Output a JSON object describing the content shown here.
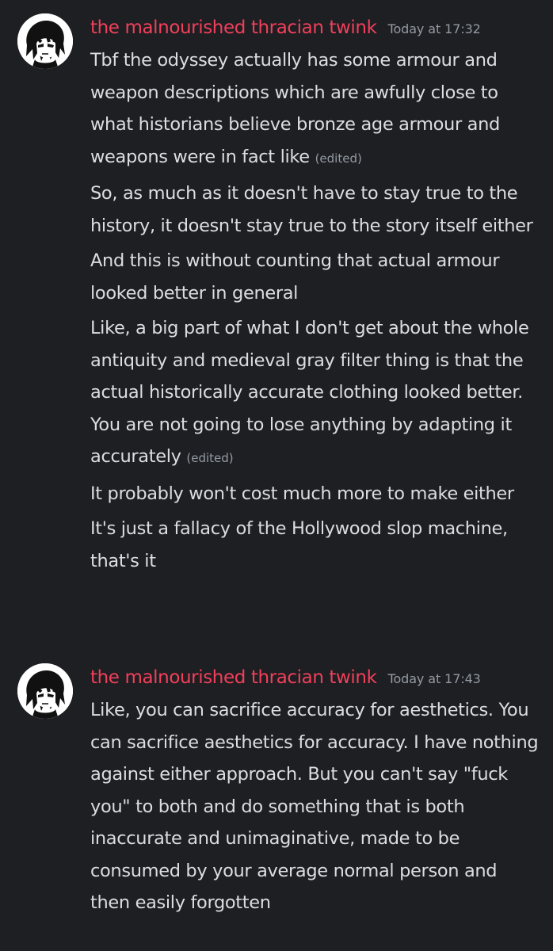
{
  "messages": [
    {
      "username": "the malnourished thracian twink",
      "timestamp": "Today at 17:32",
      "lines": [
        {
          "text": "Tbf the odyssey actually has some armour and weapon descriptions which are awfully close to what historians believe bronze age armour and weapons were in fact like",
          "edited": "(edited)"
        },
        {
          "text": "So, as much as it doesn't have to stay true to the history, it doesn't stay true to the story itself either",
          "edited": ""
        },
        {
          "text": "And this is without counting that actual armour looked better in general",
          "edited": ""
        },
        {
          "text": "Like,  a big part of what I don't get about the whole antiquity and medieval gray filter thing is that the actual historically accurate clothing looked better. You are not going to lose anything by adapting it accurately",
          "edited": "(edited)"
        },
        {
          "text": "It probably won't cost much more to make either",
          "edited": ""
        },
        {
          "text": "It's just a fallacy of the Hollywood slop machine, that's it",
          "edited": ""
        }
      ]
    },
    {
      "username": "the malnourished thracian twink",
      "timestamp": "Today at 17:43",
      "lines": [
        {
          "text": "Like, you can sacrifice accuracy for aesthetics. You can sacrifice aesthetics for accuracy. I have nothing against either approach. But you can't say \"fuck you\" to both and do something that is both inaccurate and unimaginative, made to be consumed by your average normal person and then easily forgotten",
          "edited": ""
        }
      ]
    }
  ],
  "colors": {
    "background": "#1e1f22",
    "username": "#f23f5b",
    "timestamp": "#949ba4",
    "text": "#dbdee1"
  },
  "icons": [
    "avatar-image"
  ]
}
